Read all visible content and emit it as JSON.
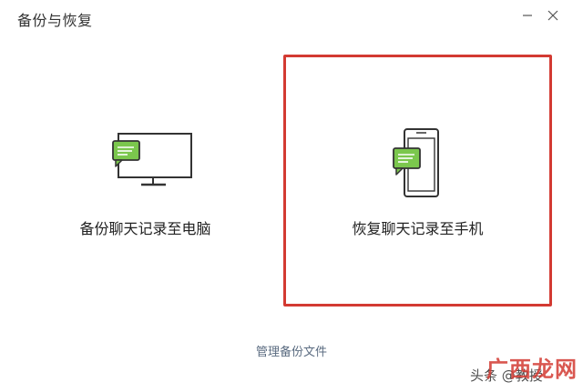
{
  "window": {
    "title": "备份与恢复",
    "minimize_icon": "minimize-icon",
    "close_icon": "close-icon"
  },
  "cards": {
    "backup": {
      "label": "备份聊天记录至电脑",
      "icon": "monitor-with-chat-icon"
    },
    "restore": {
      "label": "恢复聊天记录至手机",
      "icon": "phone-with-chat-icon",
      "selected": true
    }
  },
  "footer": {
    "manage_link": "管理备份文件"
  },
  "watermark": {
    "logo": "广西龙网",
    "user": "头条 @教授"
  },
  "colors": {
    "accent_green": "#7bc74d",
    "selection_red": "#d33a32",
    "link_color": "#5a6b80",
    "icon_stroke": "#333333"
  }
}
